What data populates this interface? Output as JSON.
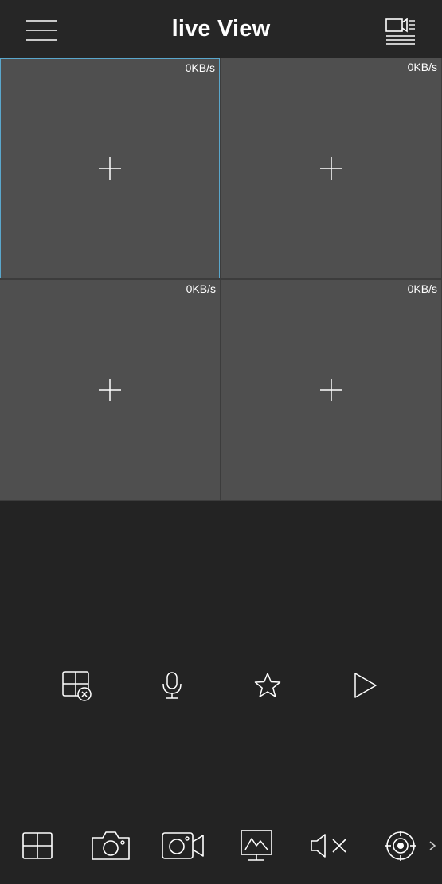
{
  "header": {
    "title": "live View",
    "menu_icon": "hamburger-menu-icon",
    "device_icon": "device-list-icon"
  },
  "grid": {
    "selected_index": 0,
    "cells": [
      {
        "rate": "0KB/s",
        "icon": "add-channel-icon"
      },
      {
        "rate": "0KB/s",
        "icon": "add-channel-icon"
      },
      {
        "rate": "0KB/s",
        "icon": "add-channel-icon"
      },
      {
        "rate": "0KB/s",
        "icon": "add-channel-icon"
      }
    ]
  },
  "actions": [
    {
      "name": "close-all-windows",
      "icon": "close-all-windows-icon"
    },
    {
      "name": "talk",
      "icon": "microphone-icon"
    },
    {
      "name": "favorite",
      "icon": "star-icon"
    },
    {
      "name": "playback",
      "icon": "play-icon"
    }
  ],
  "toolbar": [
    {
      "name": "split-screen",
      "icon": "split-screen-icon"
    },
    {
      "name": "snapshot",
      "icon": "camera-icon"
    },
    {
      "name": "record",
      "icon": "video-record-icon"
    },
    {
      "name": "image-quality",
      "icon": "image-quality-icon"
    },
    {
      "name": "audio",
      "icon": "mute-icon"
    },
    {
      "name": "ptz",
      "icon": "ptz-target-icon"
    },
    {
      "name": "more",
      "icon": "chevron-right-icon"
    }
  ],
  "colors": {
    "background": "#232323",
    "header": "#262626",
    "cell": "#4f4f4f",
    "selected_border": "#5aa7cc",
    "icon": "#ffffff"
  }
}
